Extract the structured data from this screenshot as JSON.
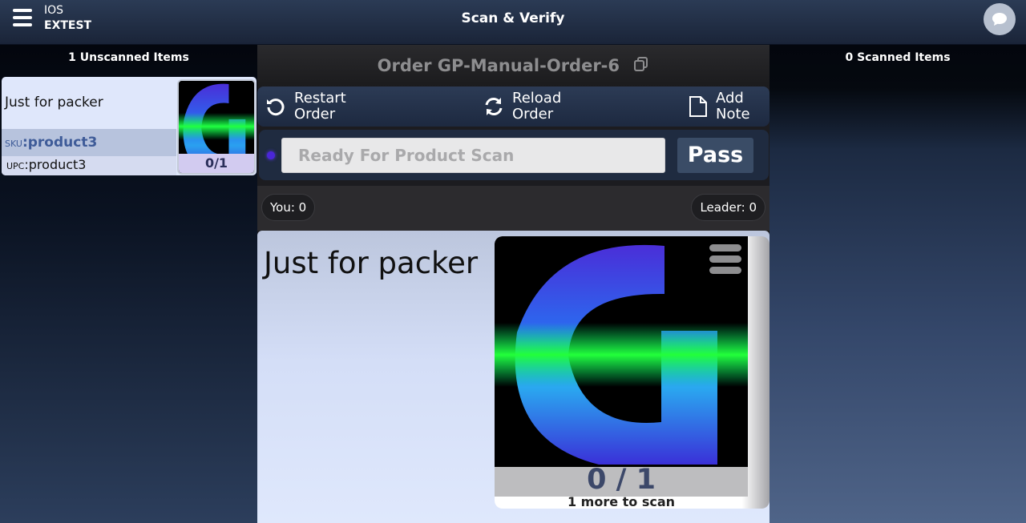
{
  "app": {
    "store_line1": "IOS",
    "store_line2": "EXTEST",
    "page_title": "Scan & Verify"
  },
  "left": {
    "header": "1 Unscanned Items",
    "items": [
      {
        "name": "Just for packer",
        "sku_label": "SKU",
        "sku": ":product3",
        "upc_label": "UPC",
        "upc": ":product3",
        "qty": "0/1"
      }
    ]
  },
  "right": {
    "header": "0 Scanned Items"
  },
  "order": {
    "title": "Order GP-Manual-Order-6"
  },
  "actions": {
    "restart_line1": "Restart",
    "restart_line2": "Order",
    "reload_line1": "Reload",
    "reload_line2": "Order",
    "note_line1": "Add",
    "note_line2": "Note"
  },
  "scan": {
    "placeholder": "Ready For Product Scan",
    "value": "",
    "pass_label": "Pass"
  },
  "score": {
    "you": "You: 0",
    "leader": "Leader: 0"
  },
  "current_product": {
    "name": "Just for packer",
    "qty": "0 / 1",
    "remaining": "1 more to scan"
  },
  "icons": {
    "menu": "hamburger-icon",
    "chat": "chat-bubble-icon",
    "copy": "copy-icon",
    "restart": "restart-icon",
    "reload": "reload-icon",
    "note": "note-icon"
  },
  "colors": {
    "scan_dot": "#4a26d8",
    "pass_button": "#3a4c66",
    "sku_text": "#3e5b98"
  }
}
